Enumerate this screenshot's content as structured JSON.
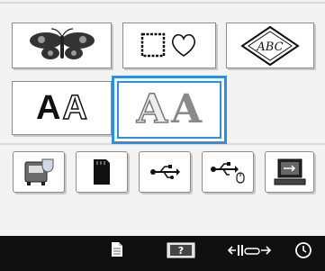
{
  "top_row": [
    {
      "name": "floral-pattern-tile",
      "icon": "butterfly-embroidery-icon"
    },
    {
      "name": "frame-shapes-tile",
      "icon": "square-heart-frame-icon"
    },
    {
      "name": "monogram-tile",
      "icon": "diamond-monogram-icon",
      "text": "ABC"
    }
  ],
  "middle_row": [
    {
      "name": "character-font-tile",
      "icon": "font-aa-icon",
      "text_a": "A",
      "text_b": "A"
    },
    {
      "name": "decorative-font-tile",
      "icon": "decorative-aa-icon",
      "selected": true,
      "text_a": "A",
      "text_b": "A"
    }
  ],
  "bottom_row": [
    {
      "name": "machine-memory-button",
      "icon": "sewing-machine-memory-icon"
    },
    {
      "name": "sd-card-button",
      "icon": "sd-card-icon"
    },
    {
      "name": "usb-button",
      "icon": "usb-icon"
    },
    {
      "name": "usb-mouse-button",
      "icon": "usb-mouse-icon"
    },
    {
      "name": "computer-usb-button",
      "icon": "computer-usb-icon"
    }
  ],
  "statusbar": {
    "items": [
      "document-icon",
      "embroidery-frame-question-icon",
      "presser-foot-width-icon",
      "clock-icon"
    ],
    "colors": {
      "background": "#101010",
      "accent": "#2d8fe0"
    }
  }
}
